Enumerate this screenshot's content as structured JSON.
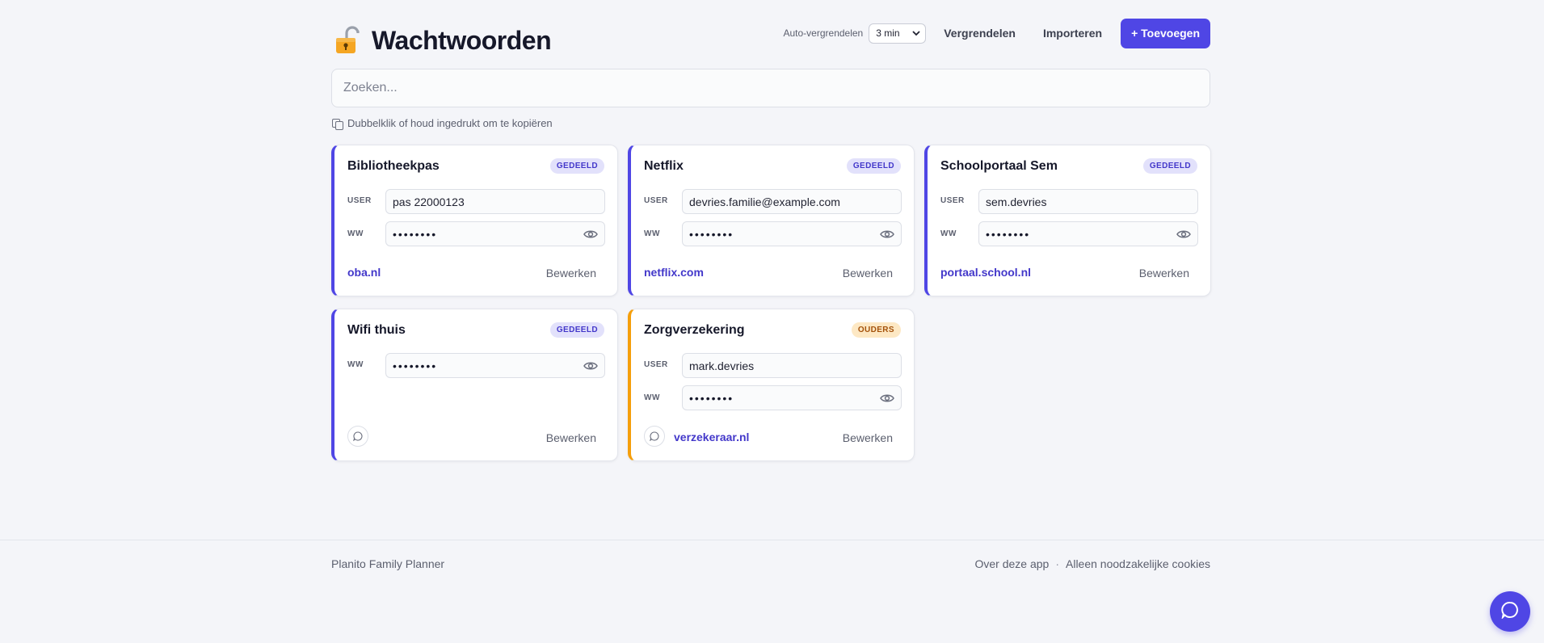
{
  "header": {
    "title": "Wachtwoorden",
    "lock_icon": "unlocked-padlock-icon",
    "autolock_label": "Auto-vergrendelen",
    "autolock_value": "3 min",
    "lock_label": "Vergrendelen",
    "import_label": "Importeren",
    "add_label": "+ Toevoegen"
  },
  "search": {
    "placeholder": "Zoeken..."
  },
  "hint": "Dubbelklik of houd ingedrukt om te kopiëren",
  "labels": {
    "user": "USER",
    "pw": "WW",
    "edit": "Bewerken",
    "masked": "••••••••"
  },
  "cards": [
    {
      "title": "Bibliotheekpas",
      "badge": "GEDEELD",
      "user": "pas 22000123",
      "link": "oba.nl"
    },
    {
      "title": "Netflix",
      "badge": "GEDEELD",
      "user": "devries.familie@example.com",
      "link": "netflix.com"
    },
    {
      "title": "Schoolportaal Sem",
      "badge": "GEDEELD",
      "user": "sem.devries",
      "link": "portaal.school.nl"
    },
    {
      "title": "Wifi thuis",
      "badge": "GEDEELD"
    },
    {
      "title": "Zorgverzekering",
      "badge": "OUDERS",
      "user": "mark.devries",
      "link": "verzekeraar.nl"
    }
  ],
  "colors": {
    "accent": "#4f46e5",
    "parents": "#f59e0b"
  },
  "footer": {
    "app_name": "Planito Family Planner",
    "about": "Over deze app",
    "separator": "·",
    "cookies": "Alleen noodzakelijke cookies"
  }
}
